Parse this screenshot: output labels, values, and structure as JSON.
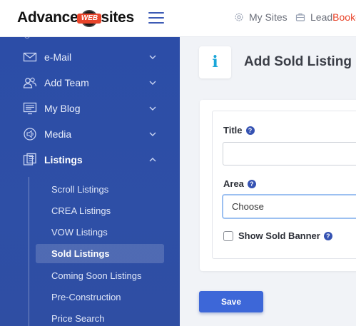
{
  "header": {
    "logo_left": "Advance",
    "logo_badge": "WEB",
    "logo_right": "sites",
    "nav": {
      "mysites": "My Sites",
      "lead_part1": "Lead",
      "lead_part2": "Booker"
    }
  },
  "sidebar": {
    "items": [
      {
        "label": "e-Mail",
        "icon": "envelope-icon"
      },
      {
        "label": "Add Team",
        "icon": "users-icon"
      },
      {
        "label": "My Blog",
        "icon": "blog-icon"
      },
      {
        "label": "Media",
        "icon": "media-icon"
      },
      {
        "label": "Listings",
        "icon": "listings-icon",
        "expanded": true
      }
    ],
    "listings_sub": [
      {
        "label": "Scroll Listings"
      },
      {
        "label": "CREA Listings"
      },
      {
        "label": "VOW Listings"
      },
      {
        "label": "Sold Listings",
        "selected": true
      },
      {
        "label": "Coming Soon Listings"
      },
      {
        "label": "Pre-Construction"
      },
      {
        "label": "Price Search"
      }
    ]
  },
  "page": {
    "icon_glyph": "i",
    "title": "Add Sold Listing"
  },
  "form": {
    "title_label": "Title",
    "title_value": "",
    "area_label": "Area",
    "area_selected": "Choose",
    "help_glyph": "?",
    "show_sold_banner_label": "Show Sold Banner",
    "show_sold_banner_checked": false,
    "save_label": "Save"
  },
  "colors": {
    "sidebar_bg": "#2c4da7",
    "accent_blue": "#3d67d8",
    "brand_red": "#e8442a",
    "info_icon": "#1aa6d9"
  }
}
